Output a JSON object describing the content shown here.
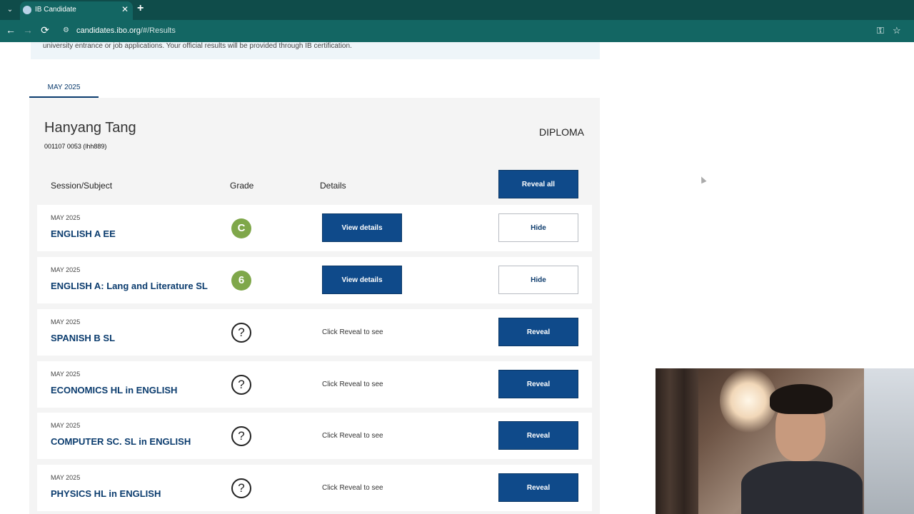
{
  "browser": {
    "tab_title": "IB Candidate",
    "tab_close": "✕",
    "new_tab": "+",
    "menu": "⌄",
    "url_host": "candidates.ibo.org",
    "url_path": "/#/Results",
    "back": "←",
    "forward": "→",
    "reload": "⟳",
    "site_icon": "⚙",
    "key_icon": "⚿",
    "star_icon": "☆"
  },
  "notice": {
    "text": "university entrance or job applications. Your official results will be provided through IB certification."
  },
  "session_tab": "MAY 2025",
  "candidate": {
    "name": "Hanyang Tang",
    "id": "001107 0053 (lhh889)",
    "type": "DIPLOMA"
  },
  "table": {
    "headers": {
      "subject": "Session/Subject",
      "grade": "Grade",
      "details": "Details"
    },
    "reveal_all": "Reveal all",
    "rows": [
      {
        "session": "MAY 2025",
        "subject": "ENGLISH A EE",
        "grade": "C",
        "details": "View details",
        "action": "Hide"
      },
      {
        "session": "MAY 2025",
        "subject": "ENGLISH A: Lang and Literature SL",
        "grade": "6",
        "details": "View details",
        "action": "Hide"
      },
      {
        "session": "MAY 2025",
        "subject": "SPANISH B SL",
        "grade": "?",
        "details": "Click Reveal to see",
        "action": "Reveal"
      },
      {
        "session": "MAY 2025",
        "subject": "ECONOMICS HL in ENGLISH",
        "grade": "?",
        "details": "Click Reveal to see",
        "action": "Reveal"
      },
      {
        "session": "MAY 2025",
        "subject": "COMPUTER SC. SL in ENGLISH",
        "grade": "?",
        "details": "Click Reveal to see",
        "action": "Reveal"
      },
      {
        "session": "MAY 2025",
        "subject": "PHYSICS HL in ENGLISH",
        "grade": "?",
        "details": "Click Reveal to see",
        "action": "Reveal"
      }
    ]
  },
  "colors": {
    "brand_navy": "#0f4a8a",
    "grade_green": "#7fa74a",
    "browser_teal": "#136663"
  }
}
